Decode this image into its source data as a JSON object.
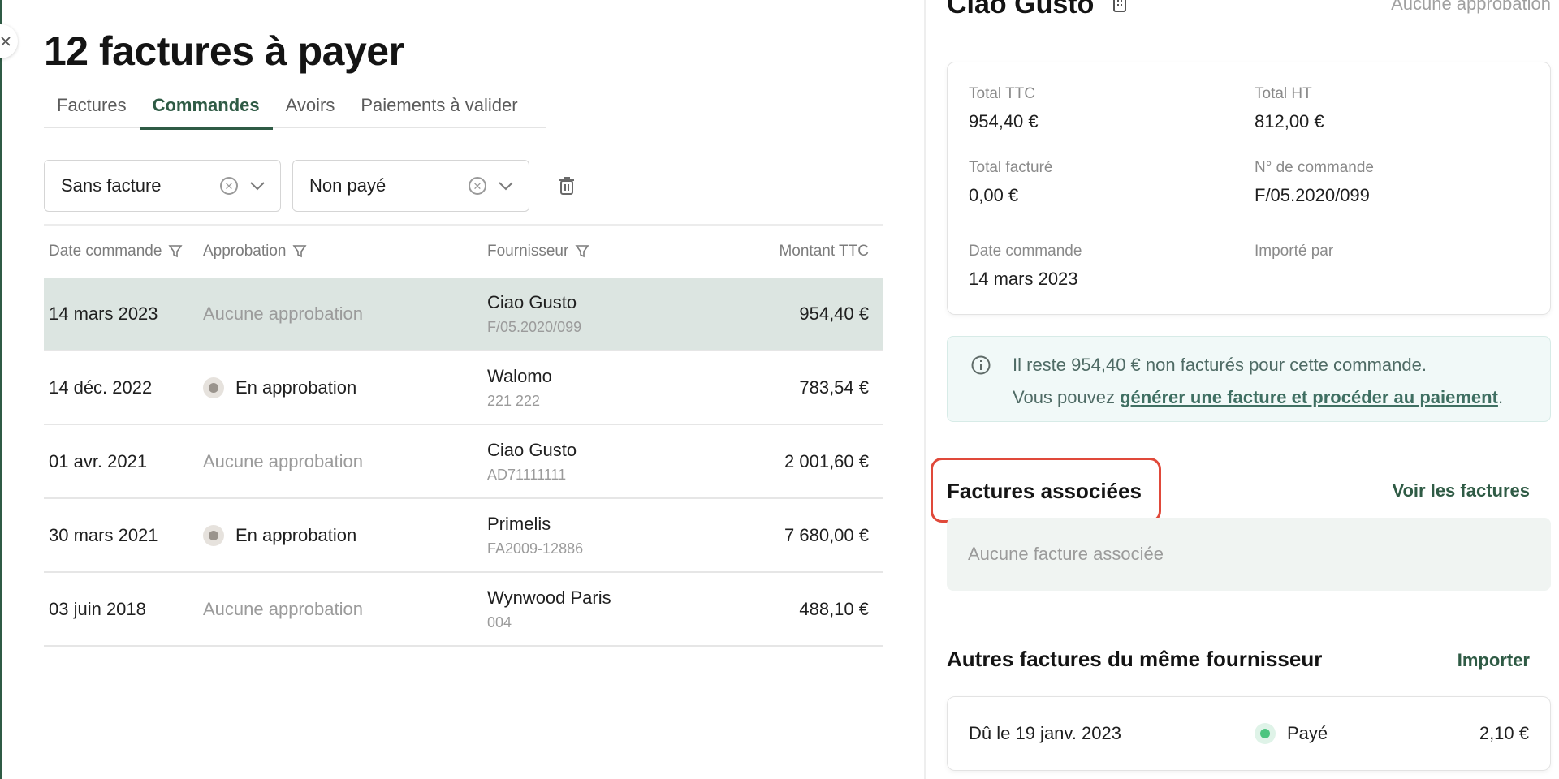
{
  "page": {
    "title": "12 factures à payer",
    "tabs": [
      {
        "label": "Factures",
        "active": false
      },
      {
        "label": "Commandes",
        "active": true
      },
      {
        "label": "Avoirs",
        "active": false
      },
      {
        "label": "Paiements à valider",
        "active": false
      }
    ]
  },
  "filters": [
    {
      "label": "Sans facture",
      "icon_clear": "clear-circle-icon",
      "icon_open": "chevron-down-icon"
    },
    {
      "label": "Non payé",
      "icon_clear": "clear-circle-icon",
      "icon_open": "chevron-down-icon"
    }
  ],
  "table": {
    "headers": {
      "date": "Date commande",
      "approval": "Approbation",
      "supplier": "Fournisseur",
      "amount": "Montant TTC"
    },
    "rows": [
      {
        "date": "14 mars 2023",
        "approval": "Aucune approbation",
        "approval_pending": false,
        "supplier": "Ciao Gusto",
        "ref": "F/05.2020/099",
        "amount": "954,40 €",
        "selected": true
      },
      {
        "date": "14 déc. 2022",
        "approval": "En approbation",
        "approval_pending": true,
        "supplier": "Walomo",
        "ref": "221 222",
        "amount": "783,54 €",
        "selected": false
      },
      {
        "date": "01 avr. 2021",
        "approval": "Aucune approbation",
        "approval_pending": false,
        "supplier": "Ciao Gusto",
        "ref": "AD71111111",
        "amount": "2 001,60 €",
        "selected": false
      },
      {
        "date": "30 mars 2021",
        "approval": "En approbation",
        "approval_pending": true,
        "supplier": "Primelis",
        "ref": "FA2009-12886",
        "amount": "7 680,00 €",
        "selected": false
      },
      {
        "date": "03 juin 2018",
        "approval": "Aucune approbation",
        "approval_pending": false,
        "supplier": "Wynwood Paris",
        "ref": "004",
        "amount": "488,10 €",
        "selected": false
      }
    ]
  },
  "detail": {
    "supplier": "Ciao Gusto",
    "approval_status": "Aucune approbation",
    "fields": {
      "total_ttc_label": "Total TTC",
      "total_ttc": "954,40 €",
      "total_ht_label": "Total HT",
      "total_ht": "812,00 €",
      "billed_label": "Total facturé",
      "billed": "0,00 €",
      "order_no_label": "N° de commande",
      "order_no": "F/05.2020/099",
      "order_date_label": "Date commande",
      "order_date": "14 mars 2023",
      "imported_by_label": "Importé par",
      "imported_by": ""
    },
    "info": {
      "line1": "Il reste 954,40 € non facturés pour cette commande.",
      "line2_prefix": "Vous pouvez ",
      "line2_link": "générer une facture et procéder au paiement",
      "line2_suffix": "."
    },
    "associated": {
      "title": "Factures associées",
      "link": "Voir les factures",
      "empty": "Aucune facture associée"
    },
    "others": {
      "title": "Autres factures du même fournisseur",
      "link": "Importer",
      "items": [
        {
          "due": "Dû le 19 janv. 2023",
          "status": "Payé",
          "amount": "2,10 €"
        }
      ]
    }
  },
  "colors": {
    "accent": "#2f5b45",
    "selected_row": "#dce5e1",
    "highlight": "#e0493a",
    "paid": "#4cc57f"
  }
}
